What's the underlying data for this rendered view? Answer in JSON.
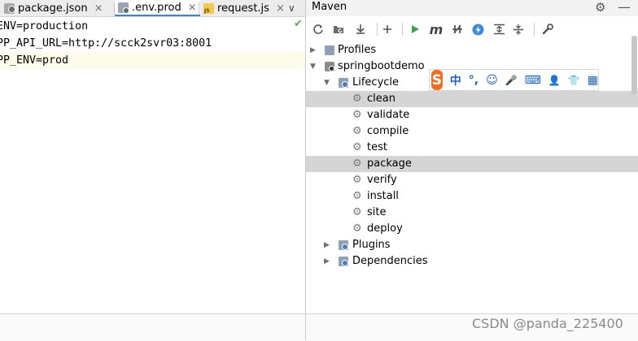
{
  "editor": {
    "tabs": [
      {
        "label": "package.json",
        "icon": "package-json-file-icon"
      },
      {
        "label": ".env.prod",
        "icon": "env-file-icon",
        "active": true
      },
      {
        "label": "request.js",
        "icon": "js-file-icon"
      }
    ],
    "tab_close": "×",
    "overflow": "∨",
    "check": "✔",
    "lines": [
      "ENV=production",
      "PP_API_URL=http://scck2svr03:8001",
      "PP_ENV=prod"
    ]
  },
  "maven": {
    "title": "Maven",
    "gear": "⚙",
    "minus": "—",
    "tree": {
      "profiles": "Profiles",
      "project": "springbootdemo",
      "lifecycle": "Lifecycle",
      "goals": [
        "clean",
        "validate",
        "compile",
        "test",
        "package",
        "verify",
        "install",
        "site",
        "deploy"
      ],
      "selected_goals": [
        "clean",
        "package"
      ],
      "plugins": "Plugins",
      "dependencies": "Dependencies"
    }
  },
  "ime": {
    "logo": "S",
    "items": [
      "中",
      "°,",
      "☺",
      "🎤",
      "⌨",
      "👤",
      "👕",
      "▦"
    ]
  },
  "watermark": "CSDN @panda_225400",
  "colors": {
    "tab_active_underline": "#4083c9",
    "selection": "#d5d5d5",
    "ime_logo": "#f36c21",
    "ime_icons": "#1c62c7",
    "run": "#3fa14f"
  }
}
